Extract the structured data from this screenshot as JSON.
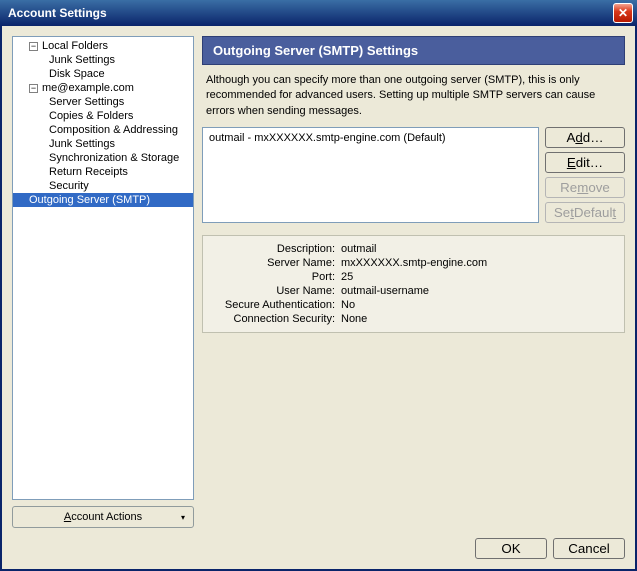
{
  "window": {
    "title": "Account Settings"
  },
  "sidebar": {
    "items": [
      {
        "label": "Local Folders",
        "level": 1,
        "expander": "−"
      },
      {
        "label": "Junk Settings",
        "level": 2
      },
      {
        "label": "Disk Space",
        "level": 2
      },
      {
        "label": "me@example.com",
        "level": 1,
        "expander": "−"
      },
      {
        "label": "Server Settings",
        "level": 2
      },
      {
        "label": "Copies & Folders",
        "level": 2
      },
      {
        "label": "Composition & Addressing",
        "level": 2
      },
      {
        "label": "Junk Settings",
        "level": 2
      },
      {
        "label": "Synchronization & Storage",
        "level": 2
      },
      {
        "label": "Return Receipts",
        "level": 2
      },
      {
        "label": "Security",
        "level": 2
      },
      {
        "label": "Outgoing Server (SMTP)",
        "level": 1,
        "selected": true,
        "indent": true
      }
    ],
    "account_actions": "Account Actions"
  },
  "content": {
    "heading": "Outgoing Server (SMTP) Settings",
    "description": "Although you can specify more than one outgoing server (SMTP), this is only recommended for advanced users. Setting up multiple SMTP servers can cause errors when sending messages.",
    "server_entry": "outmail - mxXXXXXX.smtp-engine.com (Default)",
    "buttons": {
      "add": "Add…",
      "edit": "Edit…",
      "remove": "Remove",
      "set_default": "Set Default"
    },
    "details": {
      "description_label": "Description:",
      "description_value": "outmail",
      "server_name_label": "Server Name:",
      "server_name_value": "mxXXXXXX.smtp-engine.com",
      "port_label": "Port:",
      "port_value": "25",
      "user_name_label": "User Name:",
      "user_name_value": "outmail-username",
      "secure_auth_label": "Secure Authentication:",
      "secure_auth_value": "No",
      "conn_security_label": "Connection Security:",
      "conn_security_value": "None"
    }
  },
  "footer": {
    "ok": "OK",
    "cancel": "Cancel"
  }
}
